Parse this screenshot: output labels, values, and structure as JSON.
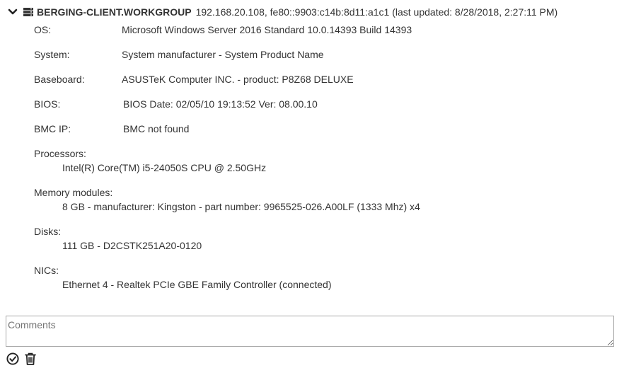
{
  "host": {
    "name": "BERGING-CLIENT.WORKGROUP",
    "meta": "192.168.20.108, fe80::9903:c14b:8d11:a1c1 (last updated: 8/28/2018, 2:27:11 PM)"
  },
  "fields": {
    "os": {
      "label": "OS:",
      "value": "Microsoft Windows Server 2016 Standard 10.0.14393 Build 14393"
    },
    "system": {
      "label": "System:",
      "value": "System manufacturer - System Product Name"
    },
    "baseboard": {
      "label": "Baseboard:",
      "value": "ASUSTeK Computer INC. - product: P8Z68 DELUXE"
    },
    "bios": {
      "label": "BIOS:",
      "value": "BIOS Date: 02/05/10 19:13:52 Ver: 08.00.10"
    },
    "bmc": {
      "label": "BMC IP:",
      "value": "BMC not found"
    }
  },
  "sections": {
    "processors": {
      "label": "Processors:",
      "items": [
        "Intel(R) Core(TM) i5-24050S CPU @ 2.50GHz"
      ]
    },
    "memory": {
      "label": "Memory modules:",
      "items": [
        "8 GB - manufacturer: Kingston - part number: 9965525-026.A00LF (1333 Mhz) x4"
      ]
    },
    "disks": {
      "label": "Disks:",
      "items": [
        "111 GB - D2CSTK251A20-0120"
      ]
    },
    "nics": {
      "label": "NICs:",
      "items": [
        "Ethernet 4 - Realtek PCIe GBE Family Controller (connected)"
      ]
    }
  },
  "comments": {
    "placeholder": "Comments",
    "value": ""
  },
  "icons": {
    "collapse": "chevron-down-icon",
    "server": "server-icon",
    "approve": "check-circle-icon",
    "delete": "trash-icon"
  }
}
